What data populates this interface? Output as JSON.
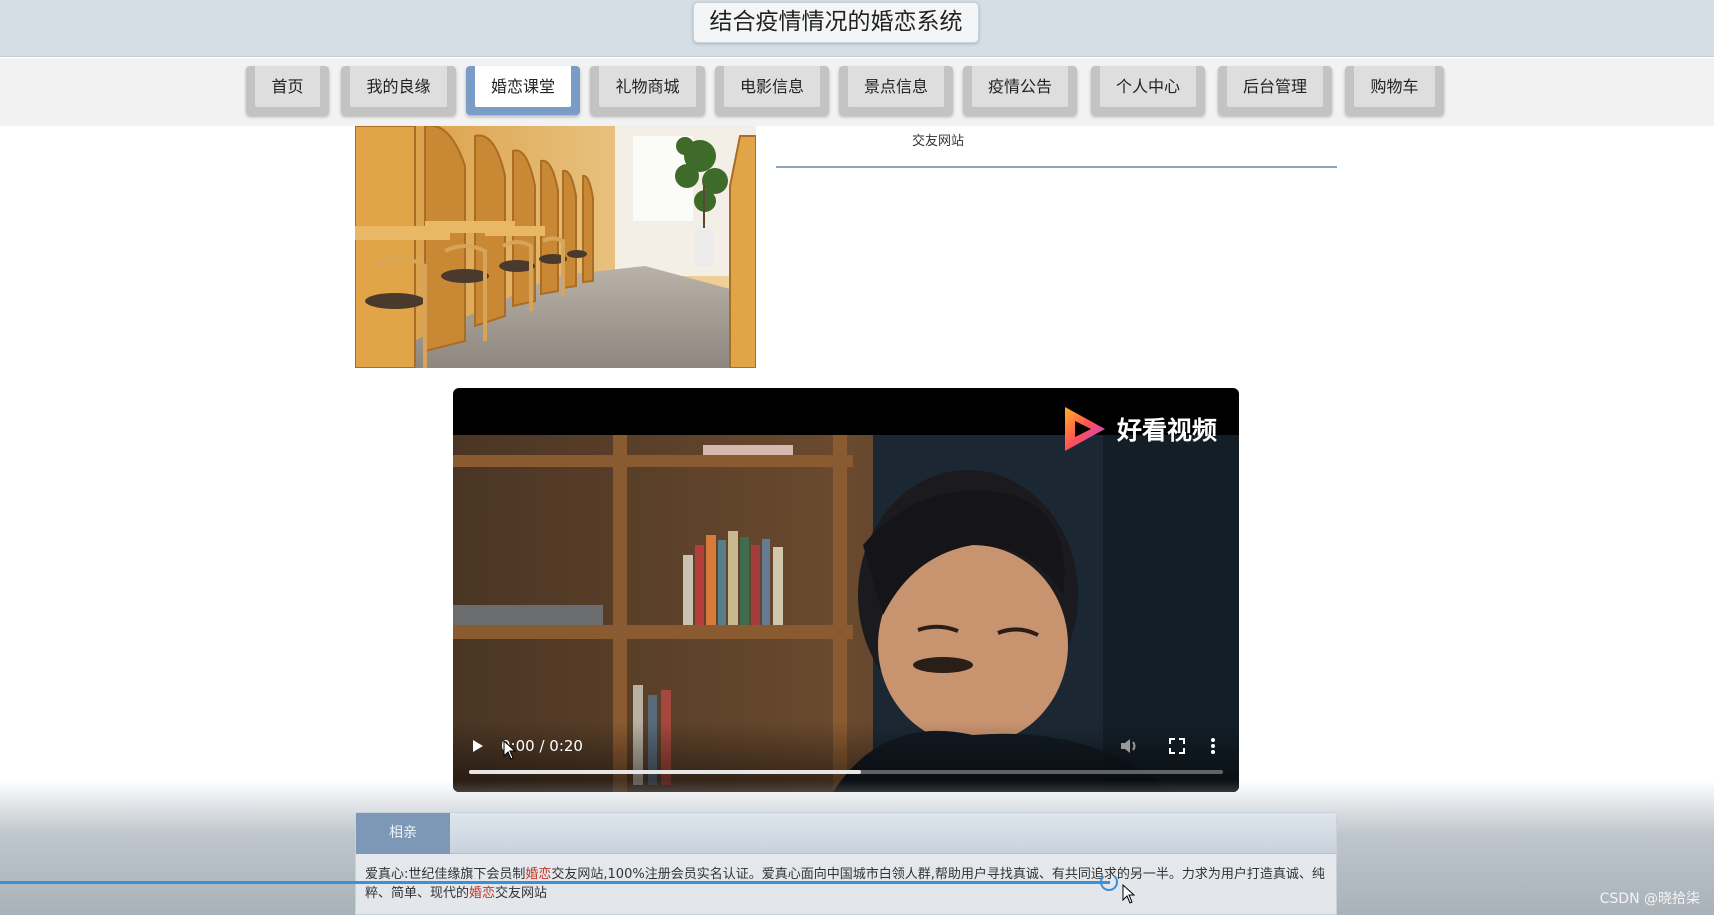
{
  "header": {
    "title": "结合疫情情况的婚恋系统"
  },
  "nav": {
    "items": [
      {
        "label": "首页"
      },
      {
        "label": "我的良缘"
      },
      {
        "label": "婚恋课堂"
      },
      {
        "label": "礼物商城"
      },
      {
        "label": "电影信息"
      },
      {
        "label": "景点信息"
      },
      {
        "label": "疫情公告"
      },
      {
        "label": "个人中心"
      },
      {
        "label": "后台管理"
      },
      {
        "label": "购物车"
      }
    ],
    "active": "婚恋课堂"
  },
  "side": {
    "label": "交友网站"
  },
  "video": {
    "brand": "好看视频",
    "time": "0:00 / 0:20",
    "progress": 0.52,
    "icons": [
      "play-icon",
      "volume-icon",
      "fullscreen-icon",
      "more-options-icon"
    ]
  },
  "panel": {
    "tab": "相亲",
    "text_parts": [
      "爱真心:世纪佳缘旗下会员制",
      "婚恋",
      "交友网站,100%注册会员实名认证。爱真心面向中国城市白领人群,帮助用户寻找真诚、有共同追求的另一半。力求为用户打造真诚、纯粹、简单、现代的",
      "婚恋",
      "交友网站"
    ]
  },
  "watermark": "CSDN @晓拾柒",
  "colors": {
    "accent": "#7b9cc6",
    "highlight": "#c0392b",
    "loading": "#3d8fd6"
  }
}
